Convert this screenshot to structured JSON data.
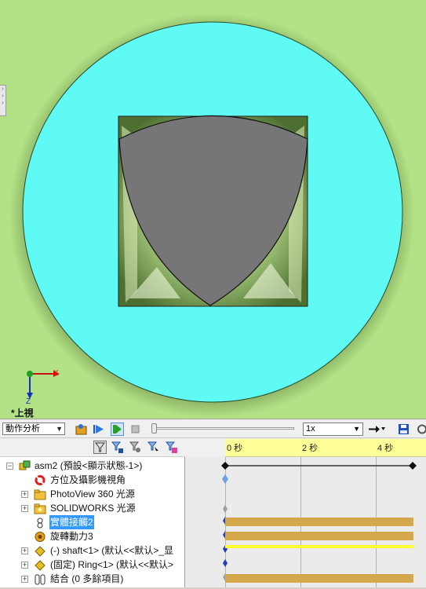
{
  "viewport": {
    "view_name": "*上視",
    "axis_x": "X",
    "axis_z": "Z",
    "colors": {
      "background": "#b2e285",
      "ring": "#5ffaf4",
      "cam_body": "#767578",
      "pocket": "#6f9a45"
    }
  },
  "toolbar": {
    "study_type": "動作分析",
    "speed": "1x",
    "buttons": [
      "calculate-icon",
      "play-from-start-icon",
      "play-icon",
      "stop-icon",
      "playback-mode-icon",
      "save-animation-icon"
    ]
  },
  "tree_toolbar": {
    "icons": [
      "filter-icon",
      "filter-animation-icon",
      "filter-driving-icon",
      "filter-selected-icon",
      "filter-results-icon"
    ]
  },
  "tree": {
    "items": [
      {
        "label": "asm2  (預設<顯示狀態-1>)",
        "expander": "−",
        "icon": "assembly-icon"
      },
      {
        "label": "方位及攝影機視角",
        "expander": "",
        "icon": "orientation-icon"
      },
      {
        "label": "PhotoView 360 光源",
        "expander": "+",
        "icon": "folder-icon"
      },
      {
        "label": "SOLIDWORKS 光源",
        "expander": "+",
        "icon": "folder-icon"
      },
      {
        "label": "實體接觸2",
        "expander": "",
        "icon": "contact-icon",
        "selected": true
      },
      {
        "label": "旋轉動力3",
        "expander": "",
        "icon": "motor-icon"
      },
      {
        "label": "(-) shaft<1> (默认<<默认>_显",
        "expander": "+",
        "icon": "part-icon"
      },
      {
        "label": "(固定) Ring<1> (默认<<默认>",
        "expander": "+",
        "icon": "part-icon"
      },
      {
        "label": "結合 (0 多餘項目)",
        "expander": "+",
        "icon": "mates-icon"
      }
    ]
  },
  "timeline": {
    "ticks": [
      {
        "label": "0 秒",
        "t": 0
      },
      {
        "label": "2 秒",
        "t": 2
      },
      {
        "label": "4 秒",
        "t": 4
      }
    ],
    "duration_s": 5,
    "colors": {
      "ruler": "#ffff99",
      "bar": "#d4a84b",
      "thin_bar": "#ffff33"
    }
  }
}
